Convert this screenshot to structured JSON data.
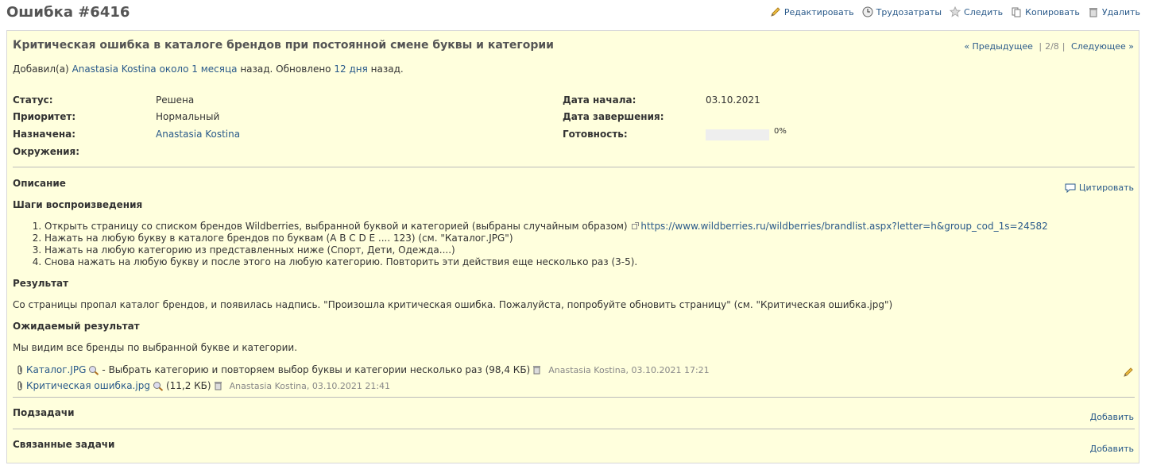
{
  "page": {
    "title": "Ошибка #6416",
    "actions": [
      {
        "label": "Редактировать",
        "icon": "pencil-icon"
      },
      {
        "label": "Трудозатраты",
        "icon": "clock-icon"
      },
      {
        "label": "Следить",
        "icon": "star-icon"
      },
      {
        "label": "Копировать",
        "icon": "copy-icon"
      },
      {
        "label": "Удалить",
        "icon": "trash-icon"
      }
    ]
  },
  "issue": {
    "subject": "Критическая ошибка в каталоге брендов при постоянной смене буквы и категории",
    "nav": {
      "prev": "« Предыдущее",
      "position": "2/8",
      "next": "Следующее »",
      "separator": "|"
    },
    "author_line": {
      "prefix": "Добавил(а)",
      "author": "Anastasia Kostina",
      "created": "около 1 месяца",
      "middle": "назад. Обновлено",
      "updated": "12 дня",
      "suffix": "назад."
    },
    "attributes": {
      "status_label": "Статус:",
      "status": "Решена",
      "priority_label": "Приоритет:",
      "priority": "Нормальный",
      "assigned_label": "Назначена:",
      "assigned": "Anastasia Kostina",
      "env_label": "Окружения:",
      "start_label": "Дата начала:",
      "start": "03.10.2021",
      "due_label": "Дата завершения:",
      "done_label": "Готовность:",
      "done_ratio": 0,
      "done_text": "0%"
    },
    "description": {
      "title": "Описание",
      "quote": "Цитировать",
      "steps_title": "Шаги воспроизведения",
      "steps": [
        "Открыть страницу со списком брендов Wildberries, выбранной буквой и категорией (выбраны случайным образом)",
        "Нажать на любую букву в каталоге брендов по буквам (A B C D E .... 123) (см. \"Каталог.JPG\")",
        "Нажать на любую категорию из представленных ниже (Спорт, Дети, Одежда....)",
        "Снова нажать на любую букву и после этого на любую категорию. Повторить эти действия еще несколько раз (3-5)."
      ],
      "step1_link": "https://www.wildberries.ru/wildberries/brandlist.aspx?letter=h&group_cod_1s=24582",
      "result_title": "Результат",
      "result": "Со страницы пропал каталог брендов, и появилась надпись. \"Произошла критическая ошибка. Пожалуйста, попробуйте обновить страницу\" (см. \"Критическая ошибка.jpg\")",
      "expected_title": "Ожидаемый результат",
      "expected": "Мы видим все бренды по выбранной букве и категории."
    },
    "attachments": [
      {
        "name": "Каталог.JPG",
        "desc": "- Выбрать категорию и повторяем выбор буквы и категории несколько раз (98,4 КБ)",
        "meta": "Anastasia Kostina, 03.10.2021 17:21"
      },
      {
        "name": "Критическая ошибка.jpg",
        "desc": "(11,2 КБ)",
        "meta": "Anastasia Kostina, 03.10.2021 21:41"
      }
    ],
    "subtasks": {
      "title": "Подзадачи",
      "add": "Добавить"
    },
    "relations": {
      "title": "Связанные задачи",
      "add": "Добавить"
    }
  }
}
